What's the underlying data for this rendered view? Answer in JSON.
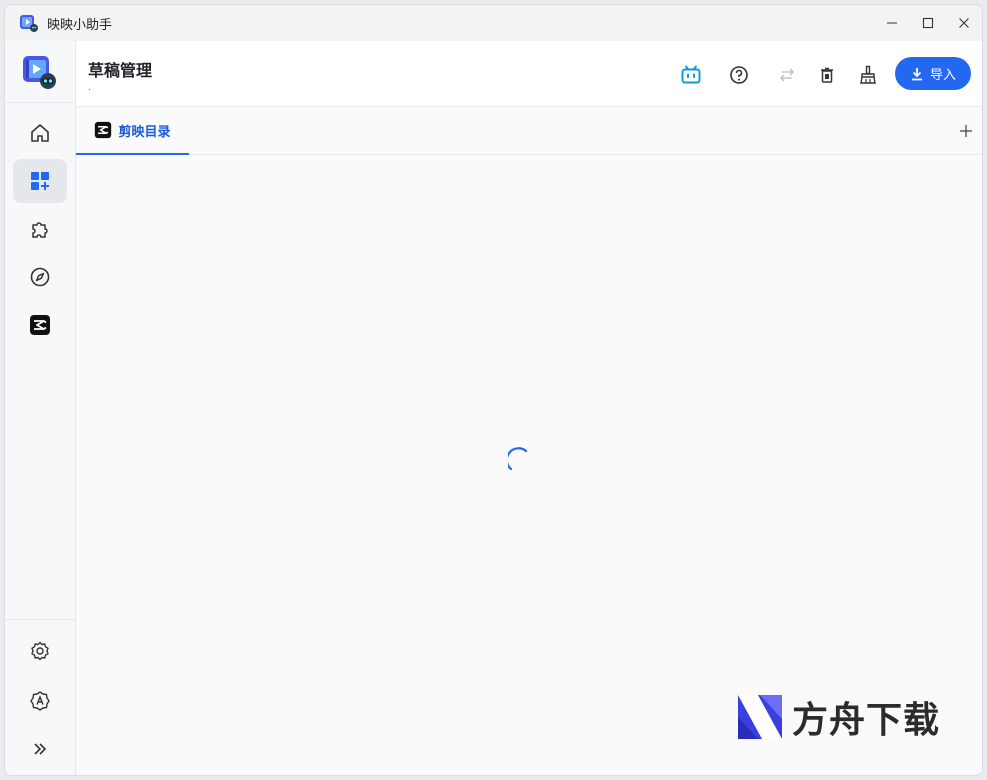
{
  "window": {
    "title": "映映小助手"
  },
  "header": {
    "title": "草稿管理",
    "subtitle": ".",
    "import_label": "导入",
    "accent": "#2468f2"
  },
  "tabs": [
    {
      "label": "剪映目录",
      "active": true
    }
  ],
  "sidebar": {
    "items": [
      {
        "icon": "home-icon"
      },
      {
        "icon": "dashboard-add-icon",
        "active": true
      },
      {
        "icon": "puzzle-icon"
      },
      {
        "icon": "compass-icon"
      },
      {
        "icon": "capcut-icon"
      }
    ],
    "bottom_items": [
      {
        "icon": "settings-icon"
      },
      {
        "icon": "admin-settings-icon"
      },
      {
        "icon": "expand-icon"
      }
    ]
  },
  "content": {
    "state": "loading"
  },
  "watermark": {
    "text": "方舟下载"
  }
}
